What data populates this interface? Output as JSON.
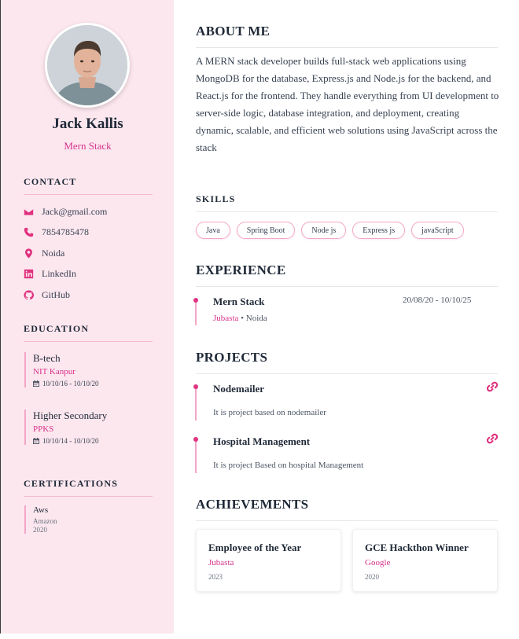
{
  "profile": {
    "name": "Jack Kallis",
    "role": "Mern Stack"
  },
  "sidebar": {
    "contact_heading": "CONTACT",
    "contacts": [
      {
        "icon": "envelope-icon",
        "text": "Jack@gmail.com"
      },
      {
        "icon": "phone-icon",
        "text": "7854785478"
      },
      {
        "icon": "map-pin-icon",
        "text": "Noida"
      },
      {
        "icon": "linkedin-icon",
        "text": "LinkedIn"
      },
      {
        "icon": "github-icon",
        "text": "GitHub"
      }
    ],
    "education_heading": "EDUCATION",
    "education": [
      {
        "title": "B-tech",
        "school": "NIT Kanpur",
        "dates": "10/10/16 - 10/10/20"
      },
      {
        "title": "Higher Secondary",
        "school": "PPKS",
        "dates": "10/10/14 - 10/10/20"
      }
    ],
    "certifications_heading": "CERTIFICATIONS",
    "certifications": [
      {
        "title": "Aws",
        "issuer": "Amazon",
        "year": "2020"
      }
    ]
  },
  "main": {
    "about_heading": "ABOUT ME",
    "about_text": "A MERN stack developer builds full-stack web applications using MongoDB for the database, Express.js and Node.js for the backend, and React.js for the frontend. They handle everything from UI development to server-side logic, database integration, and deployment, creating dynamic, scalable, and efficient web solutions using JavaScript across the stack",
    "skills_heading": "SKILLS",
    "skills": [
      "Java",
      "Spring Boot",
      "Node js",
      "Express js",
      "javaScript"
    ],
    "experience_heading": "EXPERIENCE",
    "experience": [
      {
        "title": "Mern Stack",
        "dates": "20/08/20 - 10/10/25",
        "company": "Jubasta",
        "separator": "•",
        "location": "Noida"
      }
    ],
    "projects_heading": "PROJECTS",
    "projects": [
      {
        "title": "Nodemailer",
        "description": "It is project based on nodemailer"
      },
      {
        "title": "Hospital Management",
        "description": "It is project Based on hospital Management"
      }
    ],
    "achievements_heading": "ACHIEVEMENTS",
    "achievements": [
      {
        "title": "Employee of the Year",
        "org": "Jubasta",
        "year": "2023"
      },
      {
        "title": "GCE Hackthon Winner",
        "org": "Google",
        "year": "2020"
      }
    ]
  },
  "colors": {
    "accent": "#e0327f",
    "sidebar_bg": "#fde7ef"
  }
}
